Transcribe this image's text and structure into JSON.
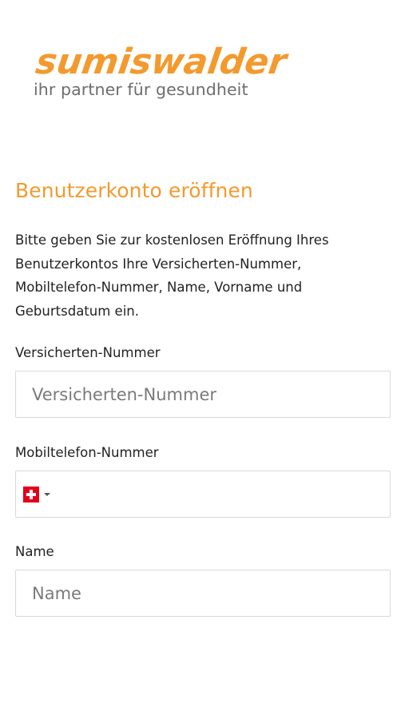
{
  "brand": {
    "logo_text": "sumiswalder",
    "tagline": "ihr partner für gesundheit",
    "accent_color": "#f39a2e"
  },
  "page": {
    "title": "Benutzerkonto eröffnen",
    "intro": "Bitte geben Sie zur kostenlosen Eröffnung Ihres Benutzerkontos Ihre Versicherten-Nummer, Mobiltelefon-Nummer, Name, Vorname und Geburtsdatum ein."
  },
  "form": {
    "insurance_number": {
      "label": "Versicherten-Nummer",
      "placeholder": "Versicherten-Nummer",
      "value": ""
    },
    "mobile_phone": {
      "label": "Mobiltelefon-Nummer",
      "country_icon": "swiss-flag-icon",
      "value": ""
    },
    "name": {
      "label": "Name",
      "placeholder": "Name",
      "value": ""
    }
  }
}
